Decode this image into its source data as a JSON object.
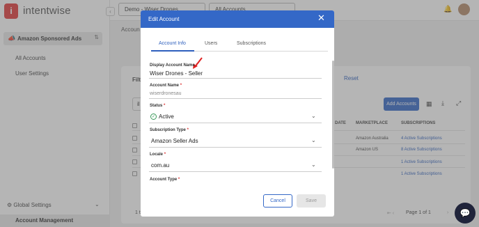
{
  "app": {
    "brand": "intentwise",
    "logo_letter": "i",
    "workspace_dropdown": "Demo - Wiser Drones",
    "accounts_dropdown": "All Accounts"
  },
  "sidebar": {
    "product": "Amazon Sponsored Ads",
    "items": [
      "All Accounts",
      "User Settings"
    ],
    "global_settings": "Global Settings",
    "account_management": "Account Management"
  },
  "page": {
    "breadcrumb": "Accoun",
    "filters_label": "Filte",
    "reset_link": "Reset",
    "search_partial": "il",
    "add_accounts": "Add Accounts",
    "table": {
      "headers": [
        "DATE",
        "MARKETPLACE",
        "SUBSCRIPTIONS"
      ],
      "rows": [
        {
          "marketplace": "Amazon Australia",
          "subscriptions": "4 Active Subscriptions"
        },
        {
          "marketplace": "Amazon US",
          "subscriptions": "8 Active Subscriptions"
        },
        {
          "marketplace": "",
          "subscriptions": "1 Active Subscriptions"
        },
        {
          "marketplace": "",
          "subscriptions": "1 Active Subscriptions"
        }
      ]
    },
    "pagination": {
      "prefix": "Page",
      "page": "1",
      "of": "of",
      "total": "1",
      "left_partial": "1 t"
    }
  },
  "modal": {
    "title": "Edit Account",
    "close_glyph": "✕",
    "tabs": [
      "Account Info",
      "Users",
      "Subscriptions"
    ],
    "active_tab": 0,
    "fields": {
      "display_name_label": "Display Account Name",
      "display_name_value": "Wiser Drones  - Seller",
      "account_name_label": "Account Name",
      "account_name_value": "wiserdronesau",
      "status_label": "Status",
      "status_value": "Active",
      "subscription_type_label": "Subscription Type",
      "subscription_type_value": "Amazon Seller Ads",
      "locale_label": "Locale",
      "locale_value": "com.au",
      "account_type_label": "Account Type",
      "required_mark": "*"
    },
    "buttons": {
      "cancel": "Cancel",
      "save": "Save"
    }
  },
  "colors": {
    "primary": "#3468c7",
    "brand_red": "#e23b3b",
    "status_green": "#3a9a5a",
    "annotation_red": "#e02020"
  },
  "icons": [
    "megaphone-icon",
    "swap-icon",
    "gear-icon",
    "chevron-down-icon",
    "bell-icon",
    "grid-icon",
    "download-icon",
    "expand-icon",
    "chat-icon",
    "close-icon",
    "check-circle-icon"
  ]
}
